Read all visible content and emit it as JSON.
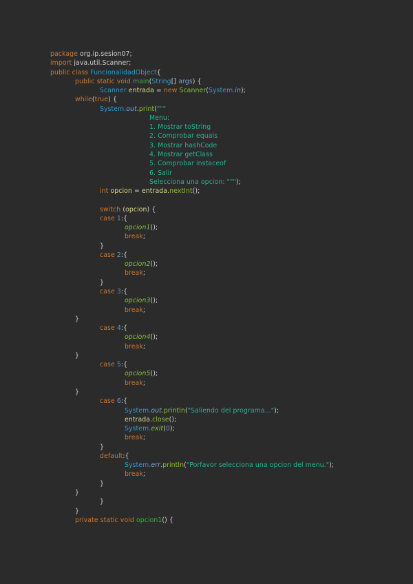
{
  "code_lines": [
    {
      "indent": 0,
      "tokens": [
        [
          "kw",
          "package "
        ],
        [
          "id",
          "org.ip.sesion07;"
        ]
      ]
    },
    {
      "indent": 0,
      "tokens": [
        [
          "kw",
          "import "
        ],
        [
          "id",
          "java.util.Scanner;"
        ]
      ]
    },
    {
      "indent": 0,
      "tokens": [
        [
          "kw",
          "public class "
        ],
        [
          "cls",
          "FuncionalidadObject"
        ],
        [
          "id",
          "{"
        ]
      ]
    },
    {
      "indent": 1,
      "tokens": [
        [
          "kw",
          "public static void "
        ],
        [
          "mth",
          "main"
        ],
        [
          "id",
          "("
        ],
        [
          "cls",
          "String"
        ],
        [
          "id",
          "[] "
        ],
        [
          "par",
          "args"
        ],
        [
          "id",
          ") {"
        ]
      ]
    },
    {
      "indent": 2,
      "tokens": [
        [
          "cls",
          "Scanner "
        ],
        [
          "var",
          "entrada"
        ],
        [
          "id",
          " = "
        ],
        [
          "kw",
          "new "
        ],
        [
          "fn",
          "Scanner"
        ],
        [
          "id",
          "("
        ],
        [
          "cls",
          "System."
        ],
        [
          "fld",
          "in"
        ],
        [
          "id",
          ");"
        ]
      ]
    },
    {
      "indent": 1,
      "tokens": [
        [
          "kw",
          "while"
        ],
        [
          "id",
          "("
        ],
        [
          "kw",
          "true"
        ],
        [
          "id",
          ") {"
        ]
      ]
    },
    {
      "indent": 2,
      "tokens": [
        [
          "cls",
          "System."
        ],
        [
          "fld",
          "out"
        ],
        [
          "id",
          "."
        ],
        [
          "fn",
          "print"
        ],
        [
          "id",
          "("
        ],
        [
          "str",
          "\"\"\""
        ]
      ]
    },
    {
      "indent": 4,
      "tokens": [
        [
          "str",
          "Menu:"
        ]
      ]
    },
    {
      "indent": 4,
      "tokens": [
        [
          "str",
          "1. Mostrar toString"
        ]
      ]
    },
    {
      "indent": 4,
      "tokens": [
        [
          "str",
          "2. Comprobar equals"
        ]
      ]
    },
    {
      "indent": 4,
      "tokens": [
        [
          "str",
          "3. Mostrar hashCode"
        ]
      ]
    },
    {
      "indent": 4,
      "tokens": [
        [
          "str",
          "4. Mostrar getClass"
        ]
      ]
    },
    {
      "indent": 4,
      "tokens": [
        [
          "str",
          "5. Comprobar instaceof"
        ]
      ]
    },
    {
      "indent": 4,
      "tokens": [
        [
          "str",
          "6. Salir"
        ]
      ]
    },
    {
      "indent": 4,
      "tokens": [
        [
          "str",
          "Selecciona una opcion: \"\"\""
        ],
        [
          "id",
          ");"
        ]
      ]
    },
    {
      "indent": 2,
      "tokens": [
        [
          "kw",
          "int "
        ],
        [
          "var",
          "opcion"
        ],
        [
          "id",
          " = "
        ],
        [
          "var",
          "entrada."
        ],
        [
          "fn",
          "nextInt"
        ],
        [
          "id",
          "();"
        ]
      ]
    },
    {
      "indent": 2,
      "tokens": []
    },
    {
      "indent": 2,
      "tokens": [
        [
          "kw",
          "switch "
        ],
        [
          "id",
          "("
        ],
        [
          "var",
          "opcion"
        ],
        [
          "id",
          ") {"
        ]
      ]
    },
    {
      "indent": 2,
      "tokens": [
        [
          "kw",
          "case "
        ],
        [
          "num",
          "1"
        ],
        [
          "id",
          ":{"
        ]
      ]
    },
    {
      "indent": 3,
      "tokens": [
        [
          "fni",
          "opcion1"
        ],
        [
          "id",
          "();"
        ]
      ]
    },
    {
      "indent": 3,
      "tokens": [
        [
          "kw",
          "break"
        ],
        [
          "id",
          ";"
        ]
      ]
    },
    {
      "indent": 2,
      "tokens": [
        [
          "id",
          "}"
        ]
      ]
    },
    {
      "indent": 2,
      "tokens": [
        [
          "kw",
          "case "
        ],
        [
          "num",
          "2"
        ],
        [
          "id",
          ":{"
        ]
      ]
    },
    {
      "indent": 3,
      "tokens": [
        [
          "fni",
          "opcion2"
        ],
        [
          "id",
          "();"
        ]
      ]
    },
    {
      "indent": 3,
      "tokens": [
        [
          "kw",
          "break"
        ],
        [
          "id",
          ";"
        ]
      ]
    },
    {
      "indent": 2,
      "tokens": [
        [
          "id",
          "}"
        ]
      ]
    },
    {
      "indent": 2,
      "tokens": [
        [
          "kw",
          "case "
        ],
        [
          "num",
          "3"
        ],
        [
          "id",
          ":{"
        ]
      ]
    },
    {
      "indent": 3,
      "tokens": [
        [
          "fni",
          "opcion3"
        ],
        [
          "id",
          "();"
        ]
      ]
    },
    {
      "indent": 3,
      "tokens": [
        [
          "kw",
          "break"
        ],
        [
          "id",
          ";"
        ]
      ]
    },
    {
      "indent": 1,
      "tokens": [
        [
          "id",
          "}"
        ]
      ]
    },
    {
      "indent": 2,
      "tokens": [
        [
          "kw",
          "case "
        ],
        [
          "num",
          "4"
        ],
        [
          "id",
          ":{"
        ]
      ]
    },
    {
      "indent": 3,
      "tokens": [
        [
          "fni",
          "opcion4"
        ],
        [
          "id",
          "();"
        ]
      ]
    },
    {
      "indent": 3,
      "tokens": [
        [
          "kw",
          "break"
        ],
        [
          "id",
          ";"
        ]
      ]
    },
    {
      "indent": 1,
      "tokens": [
        [
          "id",
          "}"
        ]
      ]
    },
    {
      "indent": 2,
      "tokens": [
        [
          "kw",
          "case "
        ],
        [
          "num",
          "5"
        ],
        [
          "id",
          ":{"
        ]
      ]
    },
    {
      "indent": 3,
      "tokens": [
        [
          "fni",
          "opcion5"
        ],
        [
          "id",
          "();"
        ]
      ]
    },
    {
      "indent": 3,
      "tokens": [
        [
          "kw",
          "break"
        ],
        [
          "id",
          ";"
        ]
      ]
    },
    {
      "indent": 1,
      "tokens": [
        [
          "id",
          "}"
        ]
      ]
    },
    {
      "indent": 2,
      "tokens": [
        [
          "kw",
          "case "
        ],
        [
          "num",
          "6"
        ],
        [
          "id",
          ":{"
        ]
      ]
    },
    {
      "indent": 3,
      "tokens": [
        [
          "cls",
          "System."
        ],
        [
          "fld",
          "out"
        ],
        [
          "id",
          "."
        ],
        [
          "fn",
          "println"
        ],
        [
          "id",
          "("
        ],
        [
          "str",
          "\"Saliendo del programa...\""
        ],
        [
          "id",
          ");"
        ]
      ]
    },
    {
      "indent": 3,
      "tokens": [
        [
          "var",
          "entrada."
        ],
        [
          "fn",
          "close"
        ],
        [
          "id",
          "();"
        ]
      ]
    },
    {
      "indent": 3,
      "tokens": [
        [
          "cls",
          "System."
        ],
        [
          "fni",
          "exit"
        ],
        [
          "id",
          "("
        ],
        [
          "num",
          "0"
        ],
        [
          "id",
          ");"
        ]
      ]
    },
    {
      "indent": 3,
      "tokens": [
        [
          "kw",
          "break"
        ],
        [
          "id",
          ";"
        ]
      ]
    },
    {
      "indent": 2,
      "tokens": [
        [
          "id",
          "}"
        ]
      ]
    },
    {
      "indent": 2,
      "tokens": [
        [
          "kw",
          "default"
        ],
        [
          "id",
          ":{"
        ]
      ]
    },
    {
      "indent": 3,
      "tokens": [
        [
          "cls",
          "System."
        ],
        [
          "fld",
          "err"
        ],
        [
          "id",
          "."
        ],
        [
          "fn",
          "println"
        ],
        [
          "id",
          "("
        ],
        [
          "str",
          "\"Porfavor selecciona una opcion del menu.\""
        ],
        [
          "id",
          ");"
        ]
      ]
    },
    {
      "indent": 3,
      "tokens": [
        [
          "kw",
          "break"
        ],
        [
          "id",
          ";"
        ]
      ]
    },
    {
      "indent": 2,
      "tokens": [
        [
          "id",
          "}"
        ]
      ]
    },
    {
      "indent": 1,
      "tokens": [
        [
          "id",
          "}"
        ]
      ]
    },
    {
      "indent": 2,
      "tokens": [
        [
          "id",
          "}"
        ]
      ]
    },
    {
      "indent": 1,
      "tokens": [
        [
          "id",
          "}"
        ]
      ]
    },
    {
      "indent": 1,
      "tokens": [
        [
          "kw",
          "private static void "
        ],
        [
          "mth",
          "opcion1"
        ],
        [
          "id",
          "() {"
        ]
      ]
    }
  ]
}
